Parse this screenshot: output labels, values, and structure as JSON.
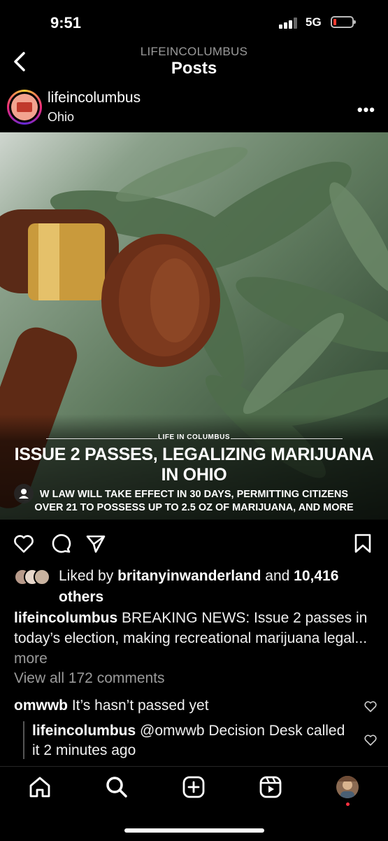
{
  "status": {
    "time": "9:51",
    "network": "5G"
  },
  "nav": {
    "account": "LIFEINCOLUMBUS",
    "title": "Posts"
  },
  "post": {
    "username": "lifeincolumbus",
    "location": "Ohio",
    "image": {
      "brand": "LIFE IN COLUMBUS",
      "headline_line1": "ISSUE 2 PASSES, LEGALIZING MARIJUANA",
      "headline_line2": "IN OHIO",
      "sub_line1": "W LAW WILL TAKE EFFECT IN 30 DAYS, PERMITTING CITIZENS",
      "sub_line2": "OVER 21 TO POSSESS UP TO 2.5 OZ OF MARIJUANA, AND MORE"
    },
    "likes": {
      "prefix": "Liked by",
      "user": "britanyinwanderland",
      "conj": "and",
      "count": "10,416",
      "suffix": "others"
    },
    "caption": {
      "username": "lifeincolumbus",
      "text": "BREAKING NEWS: Issue 2 passes in today’s election, making recreational marijuana legal...",
      "more": "more"
    },
    "view_comments": "View all 172 comments",
    "comments": [
      {
        "username": "omwwb",
        "text": "It’s hasn’t passed yet"
      },
      {
        "username": "lifeincolumbus",
        "text": "@omwwb Decision Desk called it 2 minutes ago"
      }
    ]
  },
  "colors": {
    "accent_red": "#ff3040",
    "background": "#000000",
    "muted": "#9a9a9a"
  },
  "icons": [
    "back-icon",
    "more-icon",
    "heart-icon",
    "comment-icon",
    "share-icon",
    "bookmark-icon",
    "home-icon",
    "search-icon",
    "create-icon",
    "reels-icon",
    "profile-icon"
  ]
}
